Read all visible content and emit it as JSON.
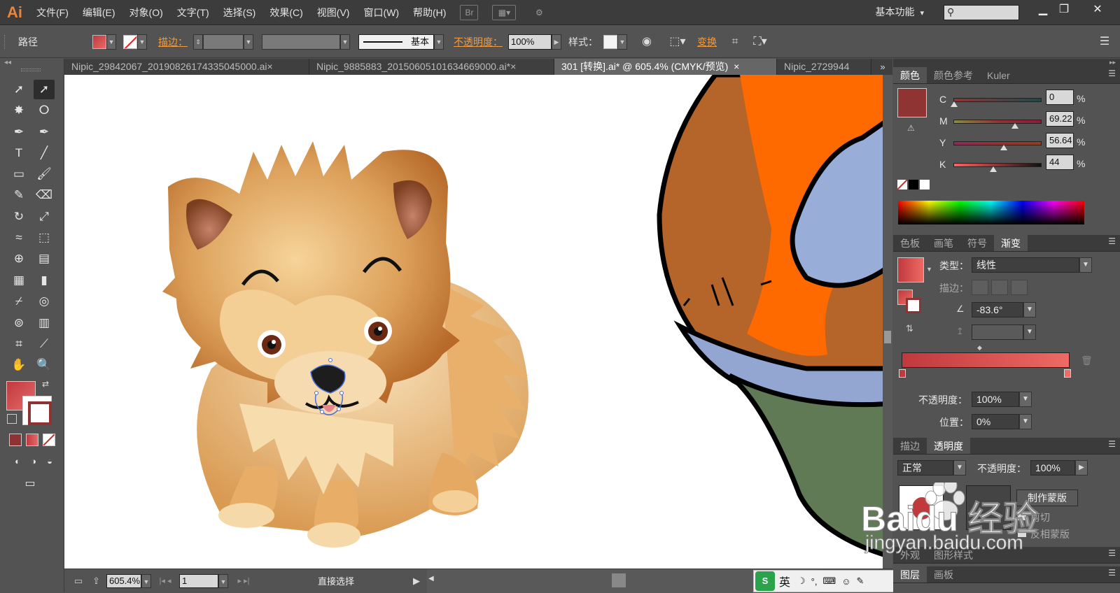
{
  "app": {
    "logo": "Ai"
  },
  "menu": [
    "文件(F)",
    "编辑(E)",
    "对象(O)",
    "文字(T)",
    "选择(S)",
    "效果(C)",
    "视图(V)",
    "窗口(W)",
    "帮助(H)"
  ],
  "menubar": {
    "bridge_label": "Br",
    "workspace": "基本功能",
    "window_buttons": [
      "▁",
      "❐",
      "✕"
    ]
  },
  "control": {
    "object_type": "路径",
    "stroke_label": "描边：",
    "stroke_profile": "基本",
    "opacity_label": "不透明度：",
    "opacity_value": "100%",
    "style_label": "样式：",
    "transform_label": "变换"
  },
  "tabs": [
    {
      "label": "Nipic_29842067_20190826174335045000.ai",
      "close": "×"
    },
    {
      "label": "Nipic_9885883_20150605101634669000.ai*",
      "close": "×"
    },
    {
      "label": "301 [转换].ai* @ 605.4% (CMYK/预览)",
      "close": "×"
    },
    {
      "label": "Nipic_2729944",
      "close": ""
    }
  ],
  "tab_overflow": "»",
  "status": {
    "zoom": "605.4%",
    "artboard": "1",
    "tool": "直接选择"
  },
  "color_panel": {
    "tabs": [
      "颜色",
      "颜色参考",
      "Kuler"
    ],
    "channels": [
      {
        "label": "C",
        "value": "0",
        "pct": 0.0
      },
      {
        "label": "M",
        "value": "69.22",
        "pct": 0.69
      },
      {
        "label": "Y",
        "value": "56.64",
        "pct": 0.57
      },
      {
        "label": "K",
        "value": "44",
        "pct": 0.44
      }
    ],
    "unit": "%",
    "fill_color": "#8f3433"
  },
  "gradient_panel": {
    "tabs": [
      "色板",
      "画笔",
      "符号",
      "渐变"
    ],
    "type_label": "类型：",
    "type_value": "线性",
    "stroke_label": "描边：",
    "angle": "-83.6°",
    "opacity_label": "不透明度：",
    "opacity_value": "100%",
    "position_label": "位置：",
    "position_value": "0%",
    "start_color": "#c0393d",
    "end_color": "#ee6a64"
  },
  "transparency_panel": {
    "tabs": [
      "描边",
      "透明度"
    ],
    "blend_mode": "正常",
    "opacity_label": "不透明度：",
    "opacity_value": "100%",
    "make_mask": "制作蒙版",
    "clip": "剪切",
    "invert_mask": "反相蒙版"
  },
  "appearance_tabs": [
    "外观",
    "图形样式"
  ],
  "layers_tabs": [
    "图层",
    "画板"
  ],
  "watermark": {
    "brand": "Baidu 经验",
    "url": "jingyan.baidu.com"
  },
  "ime": {
    "lang": "英"
  }
}
